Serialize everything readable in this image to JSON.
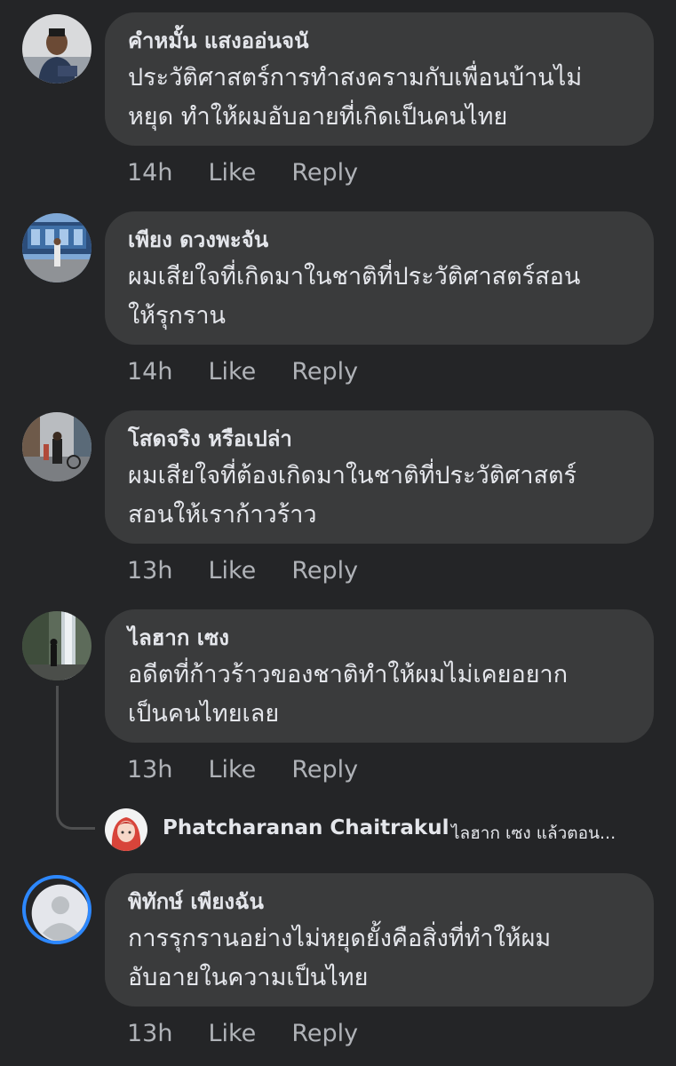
{
  "comments": [
    {
      "author": "คำหมั้น แสงออ่นจนั",
      "text": "ประวัติศาสตร์การทำสงครามกับเพื่อนบ้านไม่\nหยุด ทำให้ผมอับอายที่เกิดเป็นคนไทย",
      "time": "14h",
      "like": "Like",
      "reply": "Reply"
    },
    {
      "author": "เพียง ดวงพะจัน",
      "text": "ผมเสียใจที่เกิดมาในชาติที่ประวัติศาสตร์สอน\nให้รุกราน",
      "time": "14h",
      "like": "Like",
      "reply": "Reply"
    },
    {
      "author": "โสดจริง หรือเปล่า",
      "text": "ผมเสียใจที่ต้องเกิดมาในชาติที่ประวัติศาสตร์\nสอนให้เราก้าวร้าว",
      "time": "13h",
      "like": "Like",
      "reply": "Reply"
    },
    {
      "author": "ไลฮาก เซง",
      "text": "อดีตที่ก้าวร้าวของชาติทำให้ผมไม่เคยอยาก\nเป็นคนไทยเลย",
      "time": "13h",
      "like": "Like",
      "reply": "Reply"
    },
    {
      "author": "พิทักษ์ เพียงฉัน",
      "text": "การรุกรานอย่างไม่หยุดยั้งคือสิ่งที่ทำให้ผม\nอับอายในความเป็นไทย",
      "time": "13h",
      "like": "Like",
      "reply": "Reply"
    }
  ],
  "reply_preview": {
    "author": "Phatcharanan Chaitrakul",
    "snippet": "ไลฮาก เซง แล้วตอน..."
  },
  "colors": {
    "background": "#242527",
    "bubble": "#3a3b3c",
    "text": "#e4e6eb",
    "secondary_text": "#b0b3b8",
    "story_ring": "#2d88ff"
  }
}
